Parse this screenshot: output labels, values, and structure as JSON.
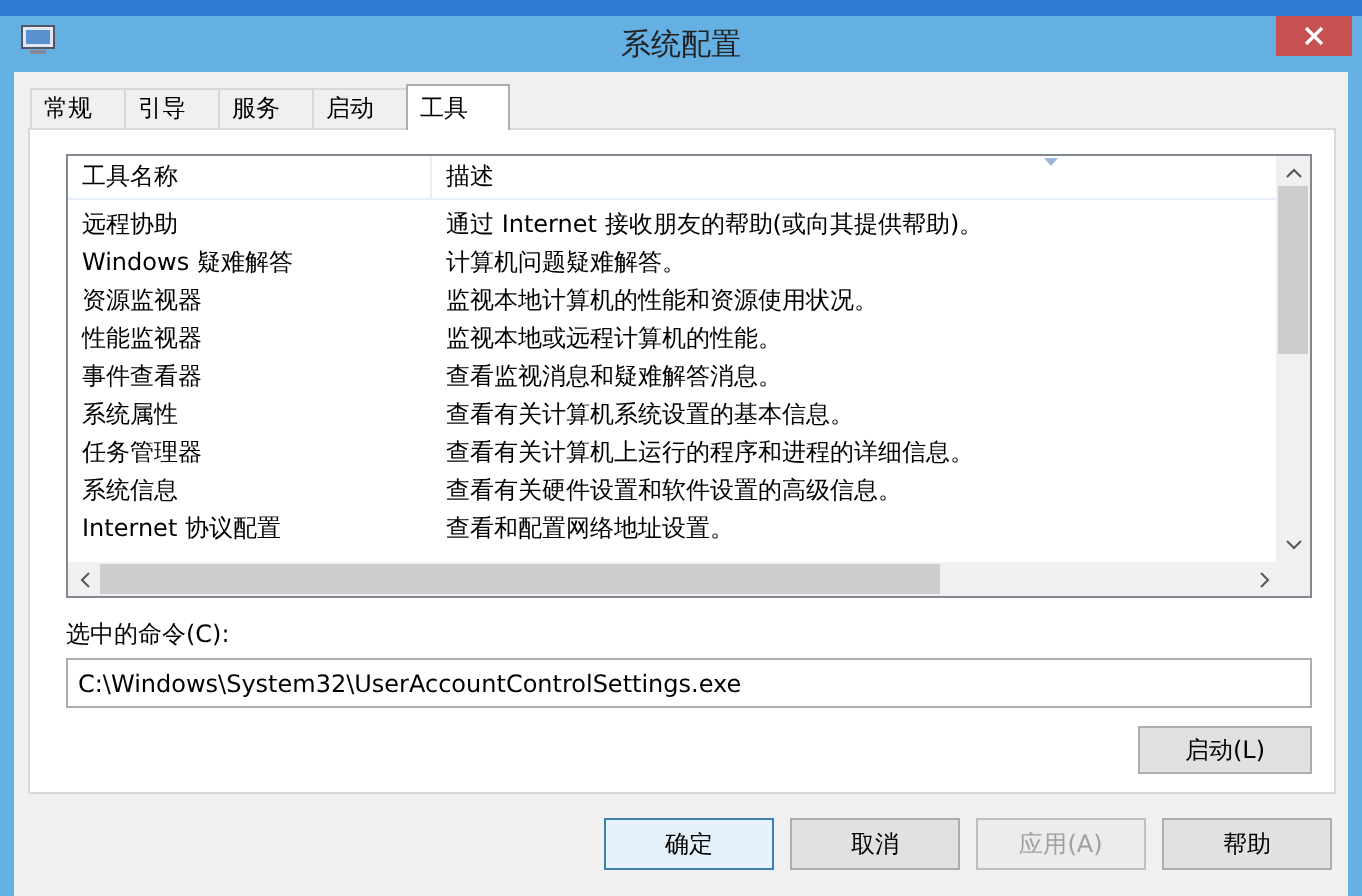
{
  "window": {
    "title": "系统配置"
  },
  "tabs": [
    {
      "label": "常规",
      "selected": false
    },
    {
      "label": "引导",
      "selected": false
    },
    {
      "label": "服务",
      "selected": false
    },
    {
      "label": "启动",
      "selected": false
    },
    {
      "label": "工具",
      "selected": true
    }
  ],
  "tools_table": {
    "columns": [
      "工具名称",
      "描述"
    ],
    "rows": [
      {
        "name": "远程协助",
        "description": "通过 Internet 接收朋友的帮助(或向其提供帮助)。"
      },
      {
        "name": "Windows 疑难解答",
        "description": "计算机问题疑难解答。"
      },
      {
        "name": "资源监视器",
        "description": "监视本地计算机的性能和资源使用状况。"
      },
      {
        "name": "性能监视器",
        "description": "监视本地或远程计算机的性能。"
      },
      {
        "name": "事件查看器",
        "description": "查看监视消息和疑难解答消息。"
      },
      {
        "name": "系统属性",
        "description": "查看有关计算机系统设置的基本信息。"
      },
      {
        "name": "任务管理器",
        "description": "查看有关计算机上运行的程序和进程的详细信息。"
      },
      {
        "name": "系统信息",
        "description": "查看有关硬件设置和软件设置的高级信息。"
      },
      {
        "name": "Internet 协议配置",
        "description": "查看和配置网络地址设置。"
      }
    ]
  },
  "selected_command": {
    "label": "选中的命令(C):",
    "value": "C:\\Windows\\System32\\UserAccountControlSettings.exe"
  },
  "launch_button": {
    "label": "启动(L)"
  },
  "buttons": [
    {
      "label": "确定",
      "default": true,
      "disabled": false
    },
    {
      "label": "取消",
      "default": false,
      "disabled": false
    },
    {
      "label": "应用(A)",
      "default": false,
      "disabled": true
    },
    {
      "label": "帮助",
      "default": false,
      "disabled": false
    }
  ]
}
